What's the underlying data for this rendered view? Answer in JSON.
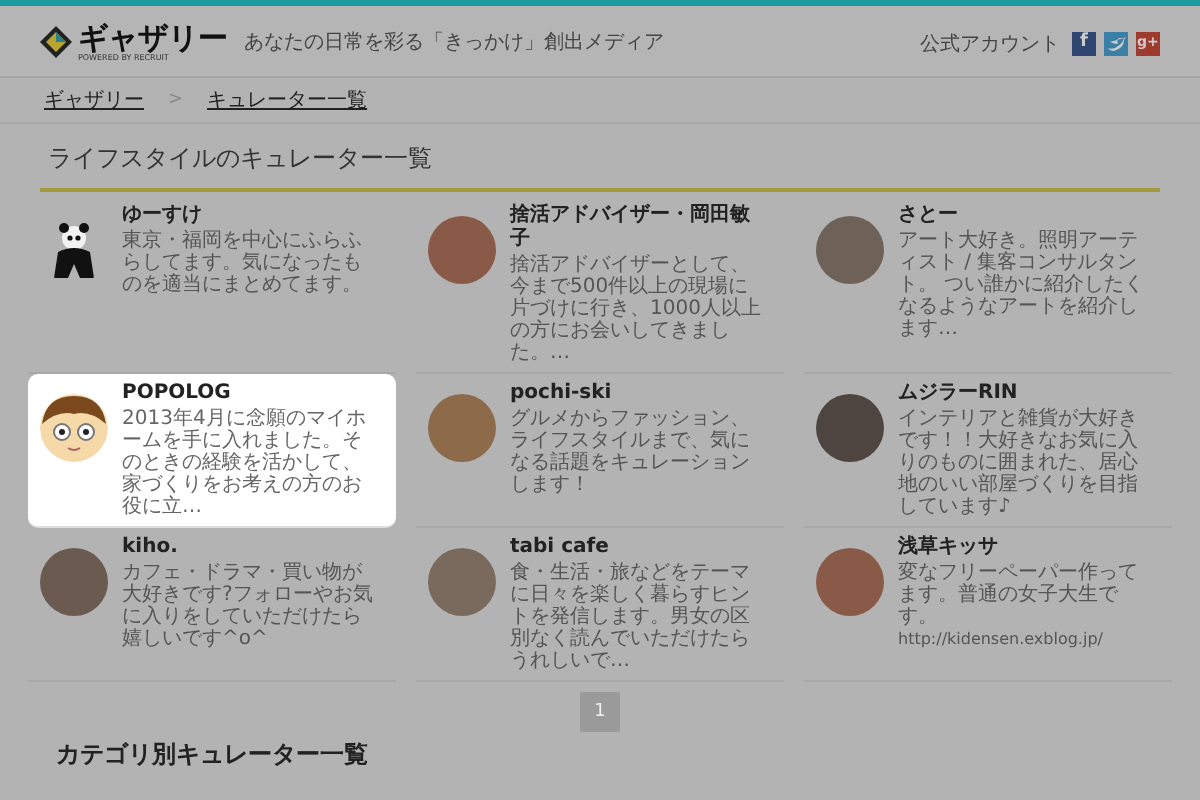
{
  "header": {
    "logo_text": "ギャザリー",
    "logo_sub": "POWERED BY RECRUIT",
    "tagline": "あなたの日常を彩る「きっかけ」創出メディア",
    "official_label": "公式アカウント",
    "social": [
      {
        "kind": "facebook",
        "glyph": "f"
      },
      {
        "kind": "twitter"
      },
      {
        "kind": "googleplus",
        "glyph": "g+"
      }
    ]
  },
  "breadcrumb": [
    "ギャザリー",
    "キュレーター一覧"
  ],
  "breadcrumb_separator": ">",
  "section_title": "ライフスタイルのキュレーター一覧",
  "curators": [
    {
      "name": "ゆーすけ",
      "description": "東京・福岡を中心にふらふらしてます。気になったものを適当にまとめてます。",
      "kind": "panda",
      "highlighted": false
    },
    {
      "name": "捨活アドバイザー・岡田敏子",
      "description": "捨活アドバイザーとして、今まで500件以上の現場に片づけに行き、1000人以上の方にお会いしてきました。…",
      "kind": "photo",
      "highlighted": false
    },
    {
      "name": "さとー",
      "description": "アート大好き。照明アーティスト / 集客コンサルタント。 つい誰かに紹介したくなるようなアートを紹介します…",
      "kind": "photo",
      "highlighted": false
    },
    {
      "name": "POPOLOG",
      "description": "2013年4月に念願のマイホームを手に入れました。そのときの経験を活かして、家づくりをお考えの方のお役に立…",
      "kind": "cartoon",
      "highlighted": true
    },
    {
      "name": "pochi-ski",
      "description": "グルメからファッション、ライフスタイルまで、気になる話題をキュレーションします！",
      "kind": "photo",
      "highlighted": false
    },
    {
      "name": "ムジラーRIN",
      "description": "インテリアと雑貨が大好きです！！大好きなお気に入りのものに囲まれた、居心地のいい部屋づくりを目指しています♪",
      "kind": "photo",
      "highlighted": false
    },
    {
      "name": "kiho.",
      "description": "カフェ・ドラマ・買い物が大好きです?フォローやお気に入りをしていただけたら嬉しいです^o^",
      "kind": "photo",
      "highlighted": false
    },
    {
      "name": "tabi cafe",
      "description": "食・生活・旅などをテーマに日々を楽しく暮らすヒントを発信します。男女の区別なく読んでいただけたらうれしいで…",
      "kind": "photo",
      "highlighted": false
    },
    {
      "name": "浅草キッサ",
      "description": "変なフリーペーパー作ってます。普通の女子大生です。",
      "url": "http://kidensen.exblog.jp/",
      "kind": "photo",
      "highlighted": false
    }
  ],
  "pagination": [
    {
      "label": "1",
      "selected": true
    }
  ],
  "next_section_title": "カテゴリ別キュレーター一覧"
}
